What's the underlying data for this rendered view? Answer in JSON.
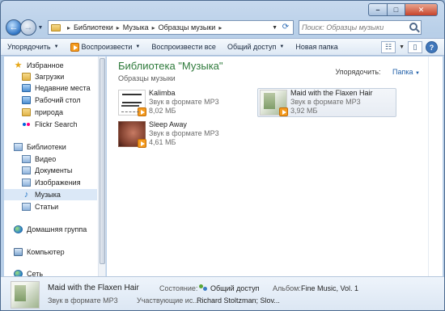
{
  "window": {
    "min_glyph": "–",
    "max_glyph": "□",
    "close_glyph": "✕"
  },
  "address": {
    "crumbs": [
      "Библиотеки",
      "Музыка",
      "Образцы музыки"
    ],
    "search_placeholder": "Поиск: Образцы музыки"
  },
  "toolbar": {
    "organize": "Упорядочить",
    "play": "Воспроизвести",
    "play_all": "Воспроизвести все",
    "share": "Общий доступ",
    "new_folder": "Новая папка"
  },
  "nav": {
    "favorites": "Избранное",
    "fav_items": [
      "Загрузки",
      "Недавние места",
      "Рабочий стол",
      "природа",
      "Flickr Search"
    ],
    "libraries": "Библиотеки",
    "lib_items": [
      "Видео",
      "Документы",
      "Изображения",
      "Музыка",
      "Статьи"
    ],
    "homegroup": "Домашняя группа",
    "computer": "Компьютер",
    "network": "Сеть"
  },
  "content": {
    "title": "Библиотека \"Музыка\"",
    "subtitle": "Образцы музыки",
    "arrange_label": "Упорядочить:",
    "arrange_value": "Папка",
    "files": [
      {
        "name": "Kalimba",
        "type": "Звук в формате MP3",
        "size": "8,02 МБ"
      },
      {
        "name": "Maid with the Flaxen Hair",
        "type": "Звук в формате MP3",
        "size": "3,92 МБ"
      },
      {
        "name": "Sleep Away",
        "type": "Звук в формате MP3",
        "size": "4,61 МБ"
      }
    ]
  },
  "details": {
    "name": "Maid with the Flaxen Hair",
    "type": "Звук в формате MP3",
    "state_label": "Состояние:",
    "state_value": "Общий доступ",
    "participants_label": "Участвующие ис...",
    "participants_value": "Richard Stoltzman; Slov...",
    "album_label": "Альбом:",
    "album_value": "Fine Music, Vol. 1"
  }
}
